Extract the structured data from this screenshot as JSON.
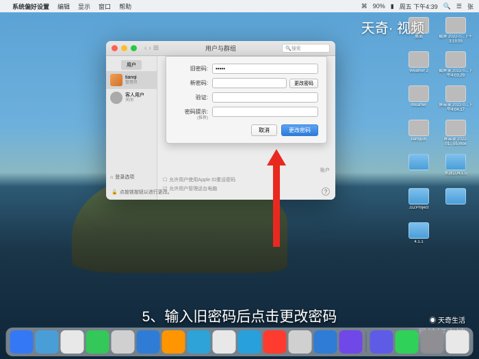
{
  "menubar": {
    "app": "系统偏好设置",
    "items": [
      "编辑",
      "显示",
      "窗口",
      "帮助"
    ],
    "battery": "90%",
    "datetime": "周五 下午4:39",
    "user": "张"
  },
  "watermark_top": "天奇· 视频",
  "window": {
    "title": "用户与群组",
    "search_placeholder": "搜索",
    "sidebar": {
      "tab": "用户",
      "users": [
        {
          "name": "tianqi",
          "role": "管理员"
        },
        {
          "name": "客人用户",
          "role": "关闭"
        }
      ],
      "login_options": "登录选项"
    },
    "sheet": {
      "old_password_label": "旧密码:",
      "old_password_value": "•••••",
      "new_password_label": "新密码:",
      "verify_label": "验证:",
      "hint_label": "密码提示:",
      "hint_sublabel": "(推荐)",
      "change_password_btn": "更改密码",
      "cancel_btn": "取消",
      "confirm_btn": "更改密码"
    },
    "main": {
      "apple_id_label": "账户",
      "checkbox1": "允许用户使用Apple ID重设密码",
      "checkbox2": "允许用户管理这台电脑"
    },
    "lock_text": "点按锁按钮以进行更改。"
  },
  "desktop_icons": [
    {
      "label": "桌面"
    },
    {
      "label": "截屏\n2022-0...下午3:19.55"
    },
    {
      "label": "Weather 2"
    },
    {
      "label": "截屏录\n2022-0...下午4:03.29"
    },
    {
      "label": "Weather"
    },
    {
      "label": "屏幕录\n2022-0...下午4:04.17"
    },
    {
      "label": "tianqijun"
    },
    {
      "label": "屏幕录\n2022-01...55.mov"
    },
    {
      "label": ""
    },
    {
      "label": "水滴DJ4.1.5"
    },
    {
      "label": "J2ZProject"
    },
    {
      "label": ""
    },
    {
      "label": "4.1.1"
    }
  ],
  "caption": "5、输入旧密码后点击更改密码",
  "watermark_br1": "天奇生活",
  "watermark_br2": "易坊好文馆",
  "dock_colors": [
    "#3478f6",
    "#4a9ed8",
    "#e8e8e8",
    "#34c759",
    "#d0d0d0",
    "#2e7cd6",
    "#ff9500",
    "#2ea3d8",
    "#e8e8e8",
    "#28a0dc",
    "#ff3b30",
    "#d0d0d0",
    "#2e7cd6",
    "#7048e8",
    "#5e5ce6",
    "#30d158",
    "#8e8e93",
    "#e8e8e8"
  ]
}
